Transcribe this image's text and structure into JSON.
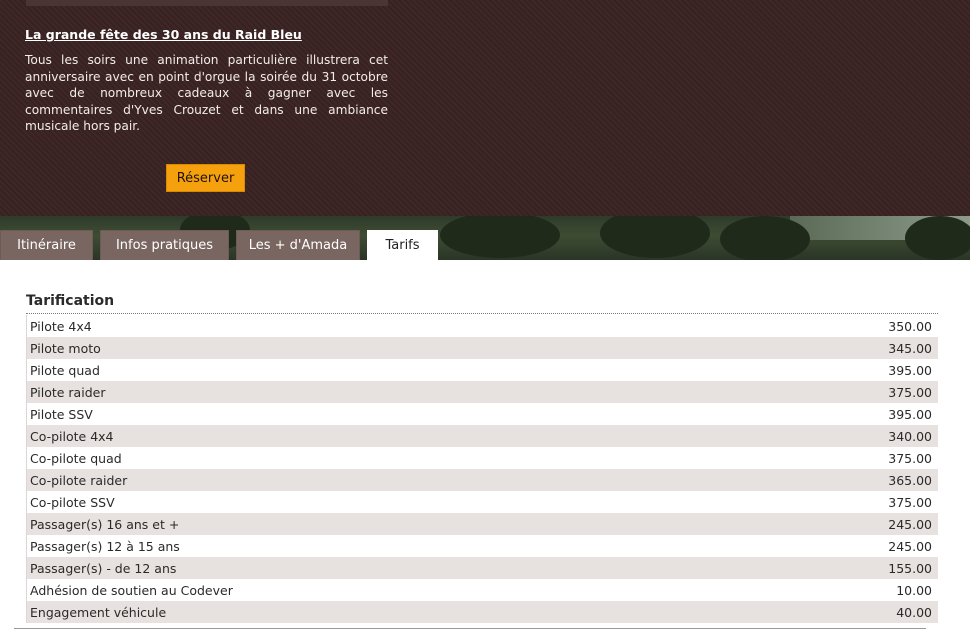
{
  "event": {
    "title": "La grande fête des 30 ans du Raid Bleu",
    "text": "Tous les soirs une animation particulière illustrera cet anniversaire avec en point d'orgue la soirée du 31 octobre avec de nombreux cadeaux à gagner avec les commentaires d'Yves Crouzet et dans une ambiance musicale hors pair.",
    "reserve_label": "Réserver"
  },
  "tabs": [
    {
      "label": "Itinéraire"
    },
    {
      "label": "Infos pratiques"
    },
    {
      "label": "Les + d'Amada"
    },
    {
      "label": "Tarifs"
    }
  ],
  "tarifs": {
    "title": "Tarification",
    "rows": [
      {
        "label": "Pilote 4x4",
        "price": "350.00"
      },
      {
        "label": "Pilote moto",
        "price": "345.00"
      },
      {
        "label": "Pilote quad",
        "price": "395.00"
      },
      {
        "label": "Pilote raider",
        "price": "375.00"
      },
      {
        "label": "Pilote SSV",
        "price": "395.00"
      },
      {
        "label": "Co-pilote 4x4",
        "price": "340.00"
      },
      {
        "label": "Co-pilote quad",
        "price": "375.00"
      },
      {
        "label": "Co-pilote raider",
        "price": "365.00"
      },
      {
        "label": "Co-pilote SSV",
        "price": "375.00"
      },
      {
        "label": "Passager(s) 16 ans et +",
        "price": "245.00"
      },
      {
        "label": "Passager(s) 12 à 15 ans",
        "price": "245.00"
      },
      {
        "label": "Passager(s) - de 12 ans",
        "price": "155.00"
      },
      {
        "label": "Adhésion de soutien au Codever",
        "price": "10.00"
      },
      {
        "label": "Engagement véhicule",
        "price": "40.00"
      }
    ]
  }
}
